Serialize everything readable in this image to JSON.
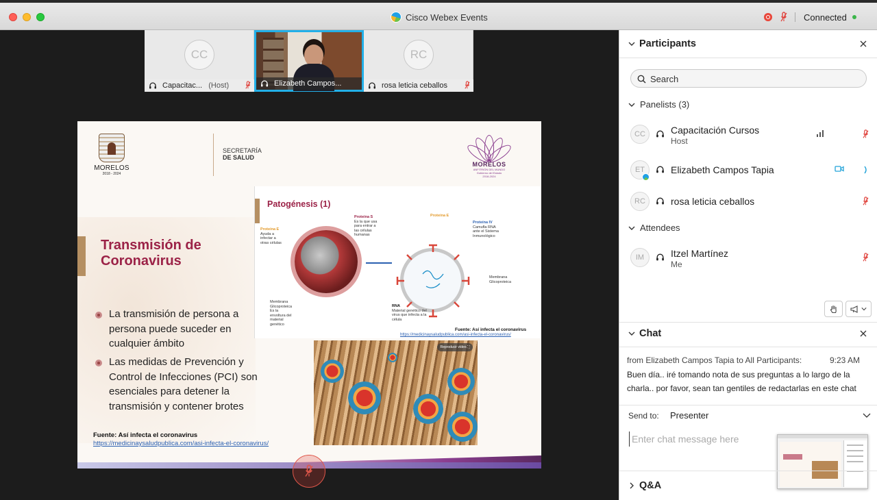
{
  "window": {
    "title": "Cisco Webex Events",
    "status": "Connected"
  },
  "thumbnails": [
    {
      "initials": "CC",
      "name": "Capacitac...",
      "role": "(Host)"
    },
    {
      "initials": "",
      "name": "Elizabeth Campos..."
    },
    {
      "initials": "RC",
      "name": "rosa leticia ceballos"
    }
  ],
  "slide": {
    "logo_left_name": "MORELOS",
    "logo_left_years": "2018 - 2024",
    "secretaria_line1": "SECRETARÍA",
    "secretaria_line2": "DE SALUD",
    "logo_right_name": "MORELOS",
    "logo_right_sub1": "ANFITRIÓN DEL MUNDO",
    "logo_right_sub2": "Gobierno del Estado",
    "logo_right_sub3": "2018-2024",
    "title": "Transmisión de Coronavirus",
    "bullets": [
      "La transmisión de persona a persona puede suceder en cualquier ámbito",
      "Las medidas de Prevención y Control de Infecciones (PCI) son esenciales para detener la transmisión y contener brotes"
    ],
    "source_title": "Fuente: Así infecta el coronavirus",
    "source_link": "https://medicinaysaludpublica.com/asi-infecta-el-coronavirus/",
    "panel": {
      "title": "Patogénesis (1)",
      "proteina_e_left": "Proteína E",
      "proteina_e_left_desc": "Ayuda a infectar a otras células",
      "proteina_s": "Proteína S",
      "proteina_s_desc": "Es la que usa para entrar a las células humanas",
      "proteina_e_top": "Proteína E",
      "proteina_iv": "Proteína IV",
      "proteina_iv_desc": "Camufla RNA ante el Sistema Inmunológico",
      "membrana_left": "Membrana Glicoproteica",
      "membrana_left_desc": "Es la envoltura del material genético",
      "rna": "RNA",
      "rna_desc": "Material genético del virus que infecta a la célula",
      "membrana_right": "Membrana Glicoproteica",
      "source": "Fuente: Así infecta el coronavirus",
      "link": "https://medicinaysaludpublica.com/asi-infecta-el-coronavirus/"
    },
    "photo_button": "Reproducir vídeo ⛶"
  },
  "participants": {
    "title": "Participants",
    "search_placeholder": "Search",
    "panelists_label": "Panelists (3)",
    "panelists": [
      {
        "initials": "CC",
        "name": "Capacitación Cursos",
        "role": "Host"
      },
      {
        "initials": "ET",
        "name": "Elizabeth Campos Tapia",
        "role": ""
      },
      {
        "initials": "RC",
        "name": "rosa leticia ceballos",
        "role": ""
      }
    ],
    "attendees_label": "Attendees",
    "attendees": [
      {
        "initials": "IM",
        "name": "Itzel Martínez",
        "role": "Me"
      }
    ]
  },
  "chat": {
    "title": "Chat",
    "from": "from Elizabeth Campos Tapia to All Participants:",
    "time": "9:23  AM",
    "message": "Buen día.. iré tomando  nota de sus preguntas a lo largo de la charla.. por favor, sean tan gentiles de redactarlas en este chat",
    "send_to_label": "Send to:",
    "send_to_value": "Presenter",
    "input_placeholder": "Enter chat message here"
  },
  "qa": {
    "title": "Q&A"
  },
  "colors": {
    "accent_blue": "#23b0e8",
    "mute_red": "#e0443e",
    "slide_title": "#9b2247"
  }
}
